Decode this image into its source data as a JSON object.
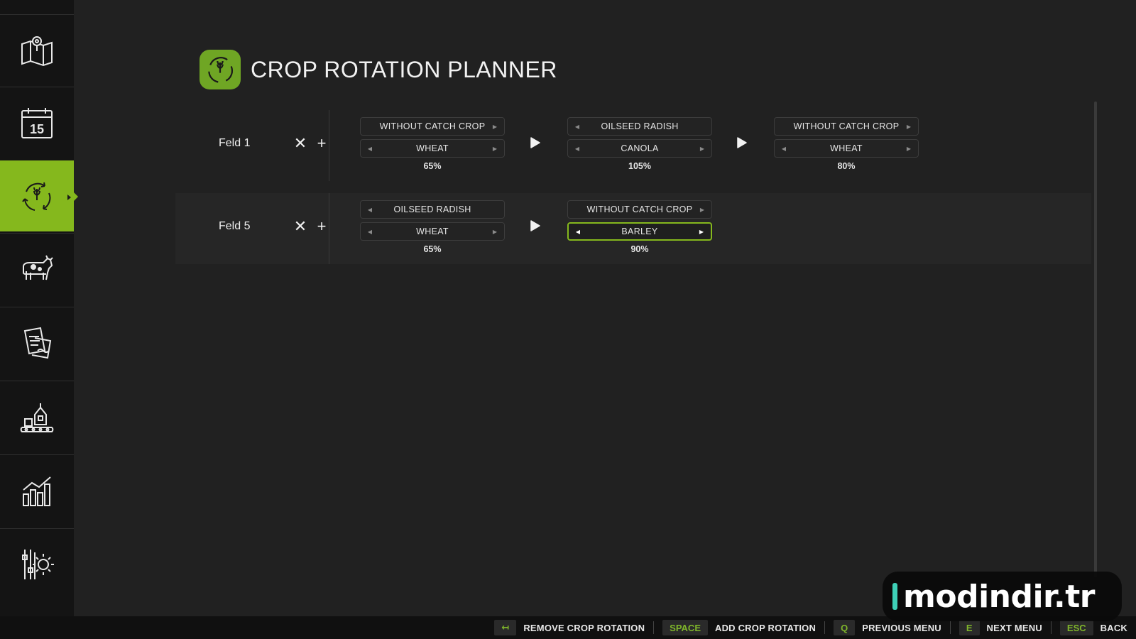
{
  "page": {
    "title": "CROP ROTATION PLANNER",
    "accent_color": "#85b81d"
  },
  "sidebar": {
    "items": [
      {
        "name": "map-icon",
        "active": false
      },
      {
        "name": "calendar-icon",
        "label": "15",
        "active": false
      },
      {
        "name": "crop-rotation-icon",
        "active": true
      },
      {
        "name": "cow-icon",
        "active": false
      },
      {
        "name": "contracts-icon",
        "active": false
      },
      {
        "name": "production-icon",
        "active": false
      },
      {
        "name": "statistics-icon",
        "active": false
      },
      {
        "name": "settings-icon",
        "active": false
      }
    ]
  },
  "rotations": [
    {
      "field": "Feld 1",
      "steps": [
        {
          "catch_crop": "WITHOUT CATCH CROP",
          "crop": "WHEAT",
          "yield": "65%"
        },
        {
          "catch_crop": "OILSEED RADISH",
          "crop": "CANOLA",
          "yield": "105%"
        },
        {
          "catch_crop": "WITHOUT CATCH CROP",
          "crop": "WHEAT",
          "yield": "80%"
        }
      ]
    },
    {
      "field": "Feld 5",
      "steps": [
        {
          "catch_crop": "OILSEED RADISH",
          "crop": "WHEAT",
          "yield": "65%"
        },
        {
          "catch_crop": "WITHOUT CATCH CROP",
          "crop": "BARLEY",
          "yield": "90%",
          "focused": true
        }
      ]
    }
  ],
  "footer": {
    "hints": [
      {
        "key": "↤",
        "label": "REMOVE CROP ROTATION"
      },
      {
        "key": "SPACE",
        "label": "ADD CROP ROTATION"
      },
      {
        "key": "Q",
        "label": "PREVIOUS MENU"
      },
      {
        "key": "E",
        "label": "NEXT MENU"
      },
      {
        "key": "ESC",
        "label": "BACK"
      }
    ]
  },
  "watermark": {
    "text": "modindir.tr"
  }
}
